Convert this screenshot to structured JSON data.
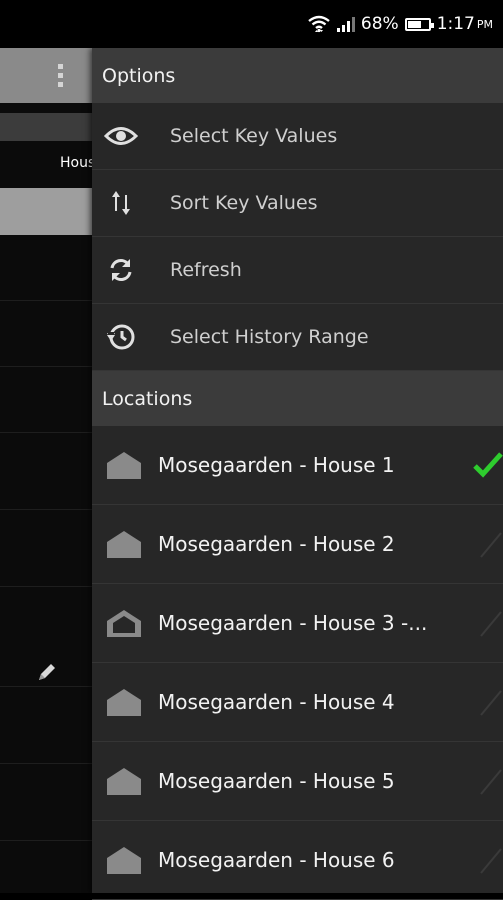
{
  "status_bar": {
    "battery_percent": "68%",
    "battery_level": 0.68,
    "time": "1:17",
    "ampm": "PM"
  },
  "background_screen": {
    "tab_label": "Hous"
  },
  "drawer": {
    "options_header": "Options",
    "options": [
      {
        "label": "Select Key Values",
        "icon": "eye-icon"
      },
      {
        "label": "Sort Key Values",
        "icon": "sort-arrows-icon"
      },
      {
        "label": "Refresh",
        "icon": "refresh-icon"
      },
      {
        "label": "Select History Range",
        "icon": "history-icon"
      }
    ],
    "locations_header": "Locations",
    "locations": [
      {
        "label": "Mosegaarden - House 1",
        "icon": "house-icon",
        "selected": true
      },
      {
        "label": "Mosegaarden - House 2",
        "icon": "house-icon",
        "selected": false
      },
      {
        "label": "Mosegaarden - House 3 -...",
        "icon": "house-outline-icon",
        "selected": false
      },
      {
        "label": "Mosegaarden - House 4",
        "icon": "house-icon",
        "selected": false
      },
      {
        "label": "Mosegaarden - House 5",
        "icon": "house-icon",
        "selected": false
      },
      {
        "label": "Mosegaarden - House 6",
        "icon": "house-icon",
        "selected": false
      }
    ]
  },
  "colors": {
    "check_selected": "#2ecc2e",
    "check_unselected": "#3a3a3a",
    "drawer_bg": "#272727",
    "header_bg": "#3b3b3b"
  }
}
